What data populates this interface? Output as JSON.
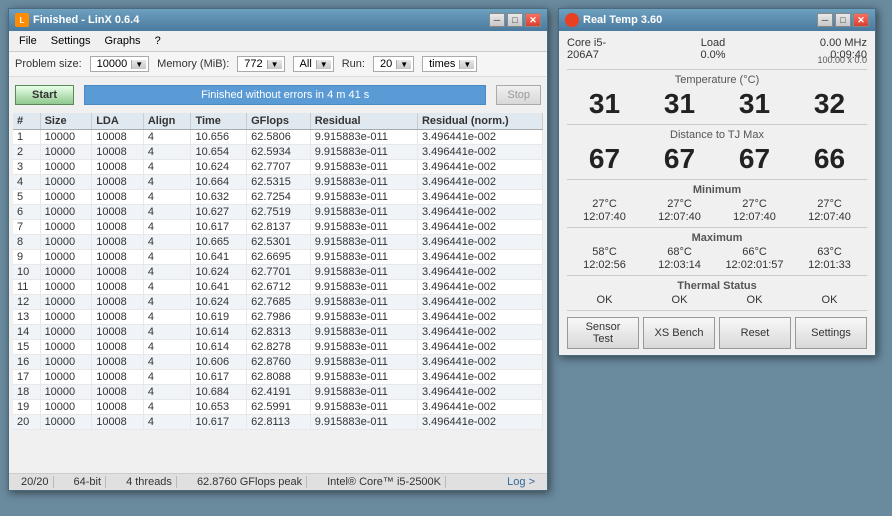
{
  "linx": {
    "title": "Finished - LinX 0.6.4",
    "menu": [
      "File",
      "Settings",
      "Graphs",
      "?"
    ],
    "problem_size_label": "Problem size:",
    "problem_size_value": "10000",
    "memory_label": "Memory (MiB):",
    "memory_value": "772",
    "filter_value": "All",
    "run_label": "Run:",
    "run_value": "20",
    "times_value": "times",
    "start_label": "Start",
    "stop_label": "Stop",
    "status_text": "Finished without errors in 4 m 41 s",
    "table_headers": [
      "#",
      "Size",
      "LDA",
      "Align",
      "Time",
      "GFlops",
      "Residual",
      "Residual (norm.)"
    ],
    "table_rows": [
      [
        1,
        10000,
        10008,
        4,
        "10.656",
        "62.5806",
        "9.915883e-011",
        "3.496441e-002"
      ],
      [
        2,
        10000,
        10008,
        4,
        "10.654",
        "62.5934",
        "9.915883e-011",
        "3.496441e-002"
      ],
      [
        3,
        10000,
        10008,
        4,
        "10.624",
        "62.7707",
        "9.915883e-011",
        "3.496441e-002"
      ],
      [
        4,
        10000,
        10008,
        4,
        "10.664",
        "62.5315",
        "9.915883e-011",
        "3.496441e-002"
      ],
      [
        5,
        10000,
        10008,
        4,
        "10.632",
        "62.7254",
        "9.915883e-011",
        "3.496441e-002"
      ],
      [
        6,
        10000,
        10008,
        4,
        "10.627",
        "62.7519",
        "9.915883e-011",
        "3.496441e-002"
      ],
      [
        7,
        10000,
        10008,
        4,
        "10.617",
        "62.8137",
        "9.915883e-011",
        "3.496441e-002"
      ],
      [
        8,
        10000,
        10008,
        4,
        "10.665",
        "62.5301",
        "9.915883e-011",
        "3.496441e-002"
      ],
      [
        9,
        10000,
        10008,
        4,
        "10.641",
        "62.6695",
        "9.915883e-011",
        "3.496441e-002"
      ],
      [
        10,
        10000,
        10008,
        4,
        "10.624",
        "62.7701",
        "9.915883e-011",
        "3.496441e-002"
      ],
      [
        11,
        10000,
        10008,
        4,
        "10.641",
        "62.6712",
        "9.915883e-011",
        "3.496441e-002"
      ],
      [
        12,
        10000,
        10008,
        4,
        "10.624",
        "62.7685",
        "9.915883e-011",
        "3.496441e-002"
      ],
      [
        13,
        10000,
        10008,
        4,
        "10.619",
        "62.7986",
        "9.915883e-011",
        "3.496441e-002"
      ],
      [
        14,
        10000,
        10008,
        4,
        "10.614",
        "62.8313",
        "9.915883e-011",
        "3.496441e-002"
      ],
      [
        15,
        10000,
        10008,
        4,
        "10.614",
        "62.8278",
        "9.915883e-011",
        "3.496441e-002"
      ],
      [
        16,
        10000,
        10008,
        4,
        "10.606",
        "62.8760",
        "9.915883e-011",
        "3.496441e-002"
      ],
      [
        17,
        10000,
        10008,
        4,
        "10.617",
        "62.8088",
        "9.915883e-011",
        "3.496441e-002"
      ],
      [
        18,
        10000,
        10008,
        4,
        "10.684",
        "62.4191",
        "9.915883e-011",
        "3.496441e-002"
      ],
      [
        19,
        10000,
        10008,
        4,
        "10.653",
        "62.5991",
        "9.915883e-011",
        "3.496441e-002"
      ],
      [
        20,
        10000,
        10008,
        4,
        "10.617",
        "62.8113",
        "9.915883e-011",
        "3.496441e-002"
      ]
    ],
    "status_bottom": [
      "20/20",
      "64-bit",
      "4 threads",
      "62.8760 GFlops peak",
      "Intel® Core™ i5-2500K",
      "Log >"
    ]
  },
  "realtemp": {
    "title": "Real Temp 3.60",
    "cpu_model": "Core i5-",
    "cpu_id": "206A7",
    "freq_mhz": "0.00 MHz",
    "freq_multi": "100.00 x 0.0",
    "load_label": "Load",
    "load_value": "0.0%",
    "uptime": "0:09:40",
    "temp_label": "Temperature (°C)",
    "temps": [
      31,
      31,
      31,
      32
    ],
    "dist_label": "Distance to TJ Max",
    "dists": [
      67,
      67,
      67,
      66
    ],
    "min_label": "Minimum",
    "min_temps": [
      "27°C",
      "27°C",
      "27°C",
      "27°C"
    ],
    "min_times": [
      "12:07:40",
      "12:07:40",
      "12:07:40",
      "12:07:40"
    ],
    "max_label": "Maximum",
    "max_temps": [
      "58°C",
      "68°C",
      "66°C",
      "63°C"
    ],
    "max_times": [
      "12:02:56",
      "12:03:14",
      "12:02:01:57",
      "12:01:33"
    ],
    "thermal_label": "Thermal Status",
    "thermal_vals": [
      "OK",
      "OK",
      "OK",
      "OK"
    ],
    "buttons": [
      "Sensor Test",
      "XS Bench",
      "Reset",
      "Settings"
    ]
  }
}
